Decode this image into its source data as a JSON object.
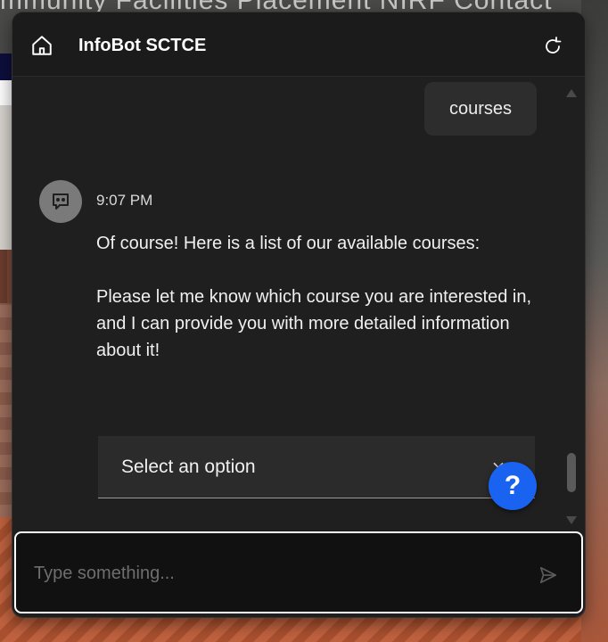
{
  "background_site": {
    "nav_text": "mmunity    Facilities    Placement    NIRF     Contact"
  },
  "chat": {
    "header": {
      "title": "InfoBot SCTCE",
      "home_icon": "home-icon",
      "refresh_icon": "refresh-icon"
    },
    "messages": {
      "user_message": "courses",
      "bot": {
        "time": "9:07 PM",
        "avatar_icon": "bot-chat-icon",
        "paragraph_1": "Of course! Here is a list of our available courses:",
        "paragraph_2": "Please let me know which course you are interested in, and I can provide you with more detailed information about it!"
      }
    },
    "select": {
      "label": "Select an option",
      "icon": "chevron-down-icon"
    },
    "help_button": {
      "label": "?",
      "color": "#1a63f0"
    },
    "input": {
      "placeholder": "Type something...",
      "value": "",
      "send_icon": "send-icon"
    }
  }
}
